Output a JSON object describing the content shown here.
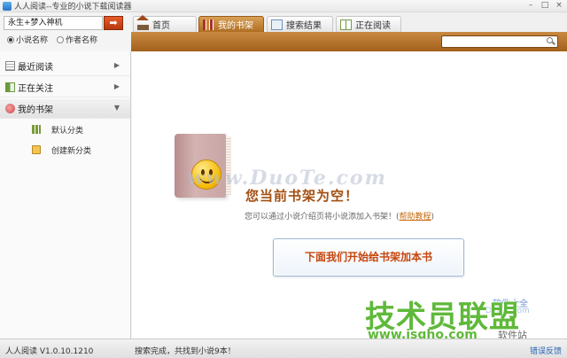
{
  "window": {
    "title": "人人阅读--专业的小说下载阅读器",
    "controls": [
      "–",
      "□",
      "×"
    ]
  },
  "search": {
    "value": "永生+梦入神机",
    "go_icon": "arrow-right-icon",
    "options": [
      {
        "label": "小说名称",
        "selected": true
      },
      {
        "label": "作者名称",
        "selected": false
      }
    ]
  },
  "tabs": [
    {
      "label": "首页",
      "icon": "home-icon",
      "active": false
    },
    {
      "label": "我的书架",
      "icon": "bookshelf-icon",
      "active": true
    },
    {
      "label": "搜索结果",
      "icon": "search-results-icon",
      "active": false
    },
    {
      "label": "正在阅读",
      "icon": "reading-icon",
      "active": false
    }
  ],
  "toolbar": {
    "search_placeholder": "",
    "search_icon": "magnifier-icon"
  },
  "sidebar": {
    "items": [
      {
        "label": "最近阅读",
        "icon": "recent-icon"
      },
      {
        "label": "正在关注",
        "icon": "follow-icon"
      },
      {
        "label": "我的书架",
        "icon": "shelf-icon"
      }
    ],
    "subitems": [
      {
        "label": "默认分类",
        "icon": "default-category-icon"
      },
      {
        "label": "创建新分类",
        "icon": "new-category-icon"
      }
    ]
  },
  "main": {
    "empty_title": "您当前书架为空！",
    "empty_desc": "您可以通过小说介绍页将小说添加入书架！",
    "help_link": "帮助教程",
    "add_button": "下面我们开始给书架加本书"
  },
  "watermarks": {
    "center": "www.DuoTe.com",
    "corner1": "软件大全",
    "corner2": "DuoTe.com",
    "big": "技术员联盟",
    "url": "www.jsgho.com",
    "url_suffix": "软件站"
  },
  "status": {
    "version": "人人阅读 V1.0.10.1210",
    "message": "搜索完成，共找到小说9本！",
    "feedback": "错误反馈"
  }
}
